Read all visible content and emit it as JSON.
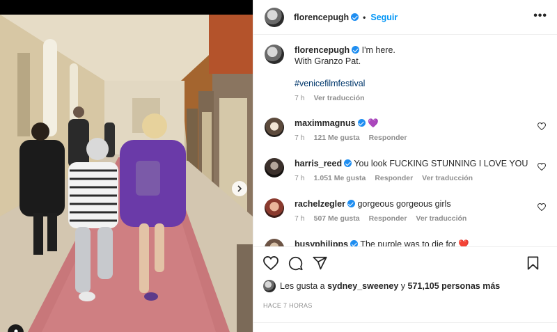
{
  "post": {
    "username": "florencepugh",
    "follow_label": "Seguir",
    "more_label": "•••",
    "separator": "•",
    "caption_line1": "I'm here.",
    "caption_line2": "With Granzo Pat.",
    "hashtag": "#venicefilmfestival",
    "caption_time": "7 h",
    "see_translation": "Ver traducción"
  },
  "comments": [
    {
      "username": "maximmagnus",
      "text": "💜",
      "time": "7 h",
      "likes": "121 Me gusta",
      "reply": "Responder",
      "translation": ""
    },
    {
      "username": "harris_reed",
      "text": "You look FUCKING STUNNING I LOVE YOU",
      "time": "7 h",
      "likes": "1.051 Me gusta",
      "reply": "Responder",
      "translation": "Ver traducción"
    },
    {
      "username": "rachelzegler",
      "text": "gorgeous gorgeous girls",
      "time": "7 h",
      "likes": "507 Me gusta",
      "reply": "Responder",
      "translation": "Ver traducción"
    },
    {
      "username": "busyphilipps",
      "text": "The purple was to die for ❤️",
      "time": "",
      "likes": "",
      "reply": "",
      "translation": ""
    }
  ],
  "likes": {
    "prefix": "Les gusta a",
    "user": "sydney_sweeney",
    "joiner": "y",
    "count": "571,105 personas más"
  },
  "timestamp": "HACE 7 HORAS",
  "carousel": {
    "total": 2,
    "current": 1
  },
  "colors": {
    "accent": "#0095f6",
    "verified": "#1f8ef1",
    "carpet": "#c8777a",
    "jacket": "#6a3aa8"
  }
}
